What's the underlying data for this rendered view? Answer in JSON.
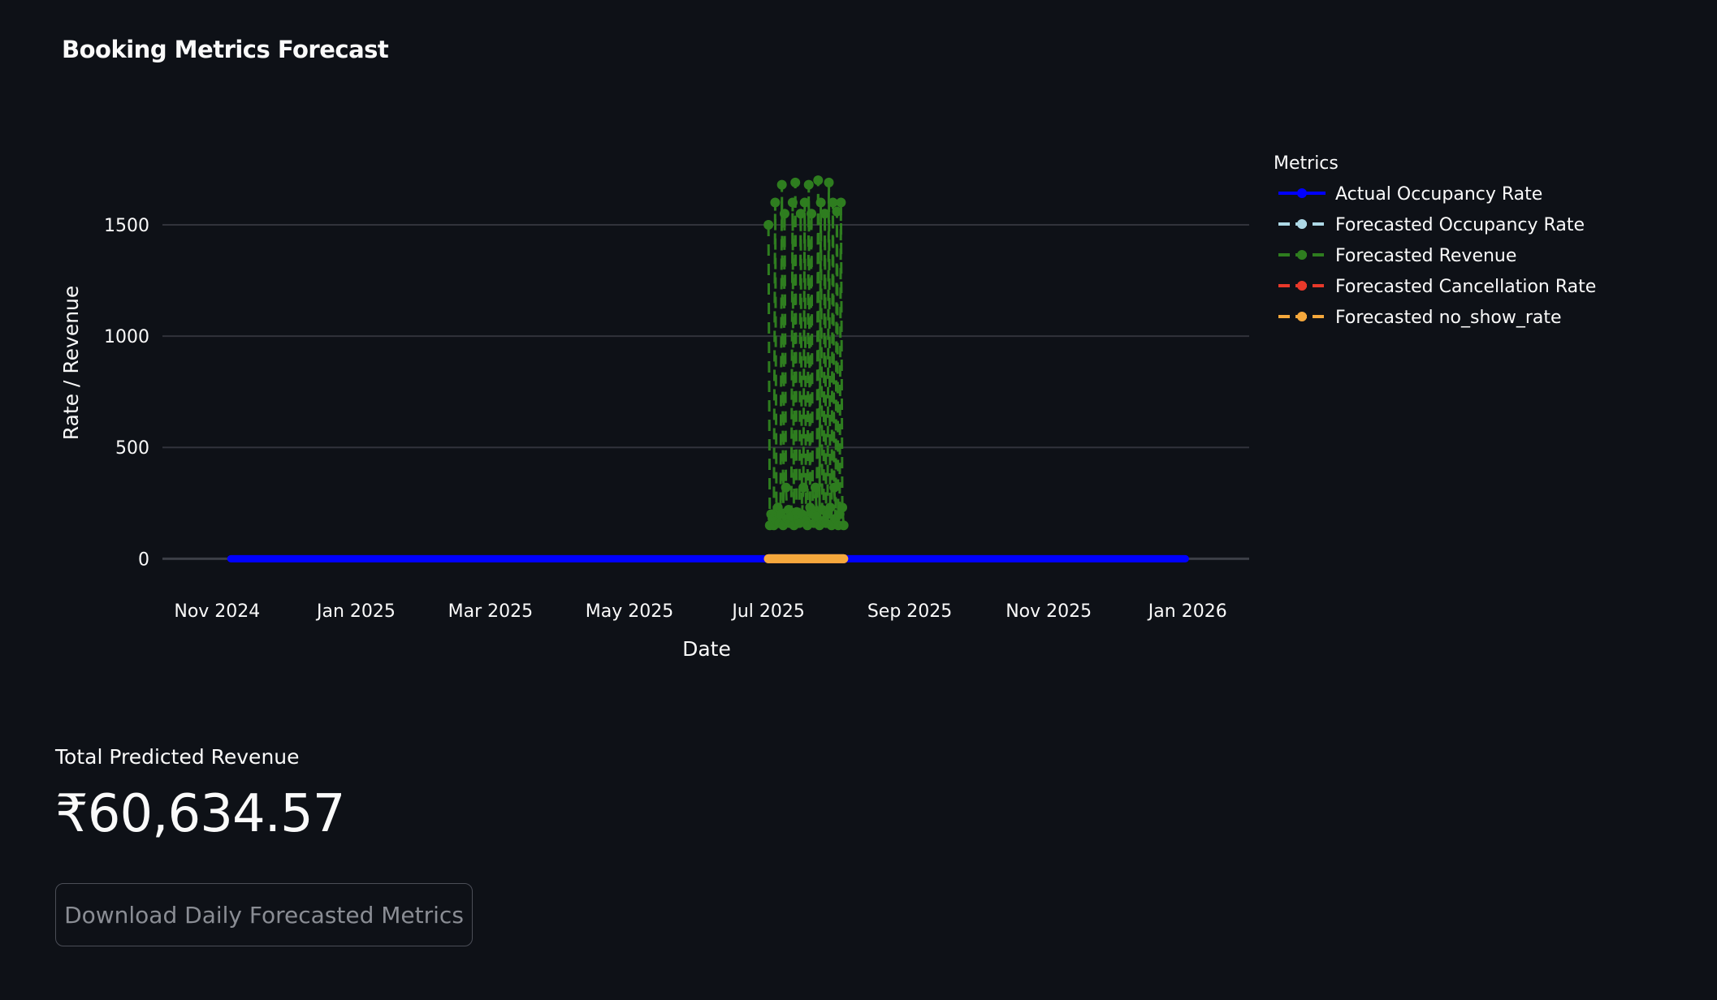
{
  "page": {
    "title": "Booking Metrics Forecast"
  },
  "metric": {
    "label": "Total Predicted Revenue",
    "value": "₹60,634.57"
  },
  "download_button": {
    "label": "Download Daily Forecasted Metrics"
  },
  "colors": {
    "background": "#0e1117",
    "actual_occupancy": "#0000ff",
    "forecast_occupancy": "#add8e6",
    "forecast_revenue": "#2e7d1f",
    "forecast_cancellation": "#e8392a",
    "forecast_no_show": "#f5a83c"
  },
  "chart_data": {
    "type": "line",
    "title": "",
    "xlabel": "Date",
    "ylabel": "Rate / Revenue",
    "xlim": [
      "2024-10-08",
      "2026-01-28"
    ],
    "ylim": [
      -170,
      1890
    ],
    "y_ticks": [
      0,
      500,
      1000,
      1500
    ],
    "x_ticks": [
      {
        "date": "2024-11-01",
        "label": "Nov 2024"
      },
      {
        "date": "2025-01-01",
        "label": "Jan 2025"
      },
      {
        "date": "2025-03-01",
        "label": "Mar 2025"
      },
      {
        "date": "2025-05-01",
        "label": "May 2025"
      },
      {
        "date": "2025-07-01",
        "label": "Jul 2025"
      },
      {
        "date": "2025-09-01",
        "label": "Sep 2025"
      },
      {
        "date": "2025-11-01",
        "label": "Nov 2025"
      },
      {
        "date": "2026-01-01",
        "label": "Jan 2026"
      }
    ],
    "grid": true,
    "legend_title": "Metrics",
    "legend_position": "right",
    "series": [
      {
        "name": "Actual Occupancy Rate",
        "color": "#0000ff",
        "dash": "solid",
        "x_start": "2024-11-07",
        "x_end": "2025-12-31",
        "approx_value": 0
      },
      {
        "name": "Forecasted Occupancy Rate",
        "color": "#add8e6",
        "dash": "dash",
        "x_start": "2025-07-01",
        "x_end": "2025-08-03",
        "approx_value": 0
      },
      {
        "name": "Forecasted Revenue",
        "color": "#2e7d1f",
        "dash": "dash",
        "x_start": "2025-07-01",
        "x_end": "2025-08-03",
        "values": [
          1500,
          150,
          200,
          180,
          150,
          1600,
          170,
          230,
          160,
          200,
          1680,
          150,
          1550,
          320,
          180,
          220,
          160,
          190,
          1600,
          150,
          1690,
          210,
          180,
          160,
          1550,
          200,
          320,
          1600,
          170,
          150,
          1680,
          230,
          1550,
          200,
          160,
          320,
          190,
          1700,
          150,
          1600,
          220,
          170,
          1550,
          160,
          200,
          1690,
          230,
          150,
          1600,
          320,
          180,
          1560,
          150,
          200,
          1600,
          230,
          150
        ]
      },
      {
        "name": "Forecasted Cancellation Rate",
        "color": "#e8392a",
        "dash": "dash",
        "x_start": "2025-07-01",
        "x_end": "2025-08-03",
        "approx_value": 0
      },
      {
        "name": "Forecasted no_show_rate",
        "color": "#f5a83c",
        "dash": "dash",
        "x_start": "2025-07-01",
        "x_end": "2025-08-03",
        "approx_value": 0
      }
    ]
  }
}
